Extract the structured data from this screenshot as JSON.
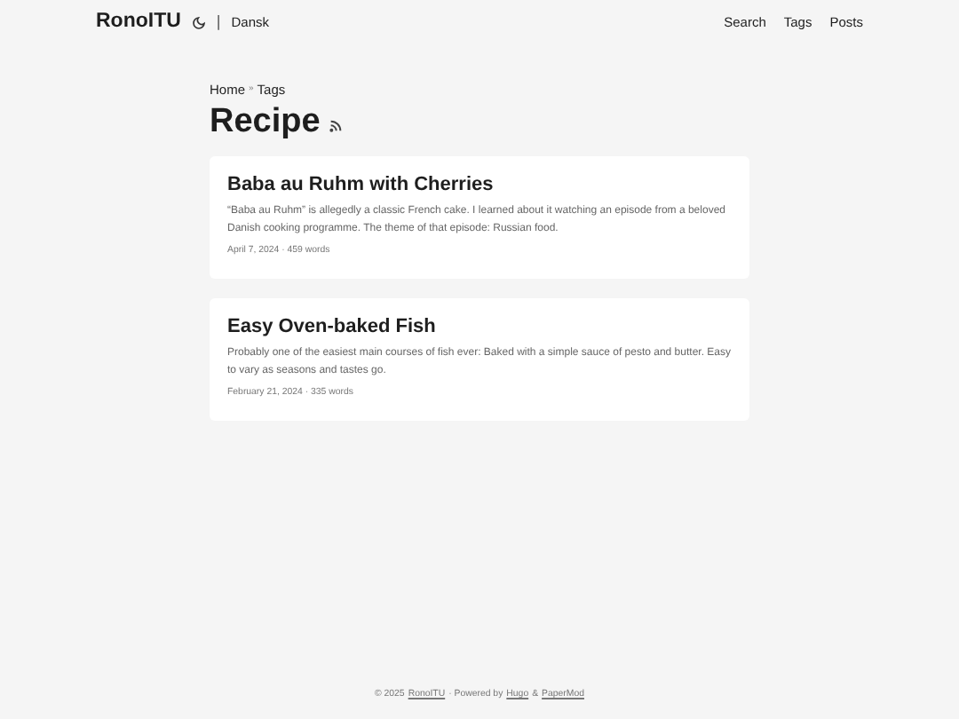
{
  "header": {
    "logo": "RonoITU",
    "separator": "|",
    "language": "Dansk",
    "menu": [
      "Search",
      "Tags",
      "Posts"
    ]
  },
  "breadcrumbs": {
    "items": [
      "Home",
      "Tags"
    ],
    "separator": "»"
  },
  "title": "Recipe",
  "posts": [
    {
      "title": "Baba au Ruhm with Cherries",
      "summary": "“Baba au Ruhm” is allegedly a classic French cake. I learned about it watching an episode from a beloved Danish cooking programme. The theme of that episode: Russian food.",
      "meta": "April 7, 2024 · 459 words"
    },
    {
      "title": "Easy Oven-baked Fish",
      "summary": "Probably one of the easiest main courses of fish ever: Baked with a simple sauce of pesto and butter. Easy to vary as seasons and tastes go.",
      "meta": "February 21, 2024 · 335 words"
    }
  ],
  "footer": [
    {
      "kind": "text",
      "text": "© 2025"
    },
    {
      "kind": "link",
      "text": "RonoITU"
    },
    {
      "kind": "text",
      "text": "· Powered by"
    },
    {
      "kind": "link",
      "text": "Hugo"
    },
    {
      "kind": "text",
      "text": "&"
    },
    {
      "kind": "link",
      "text": "PaperMod"
    }
  ]
}
